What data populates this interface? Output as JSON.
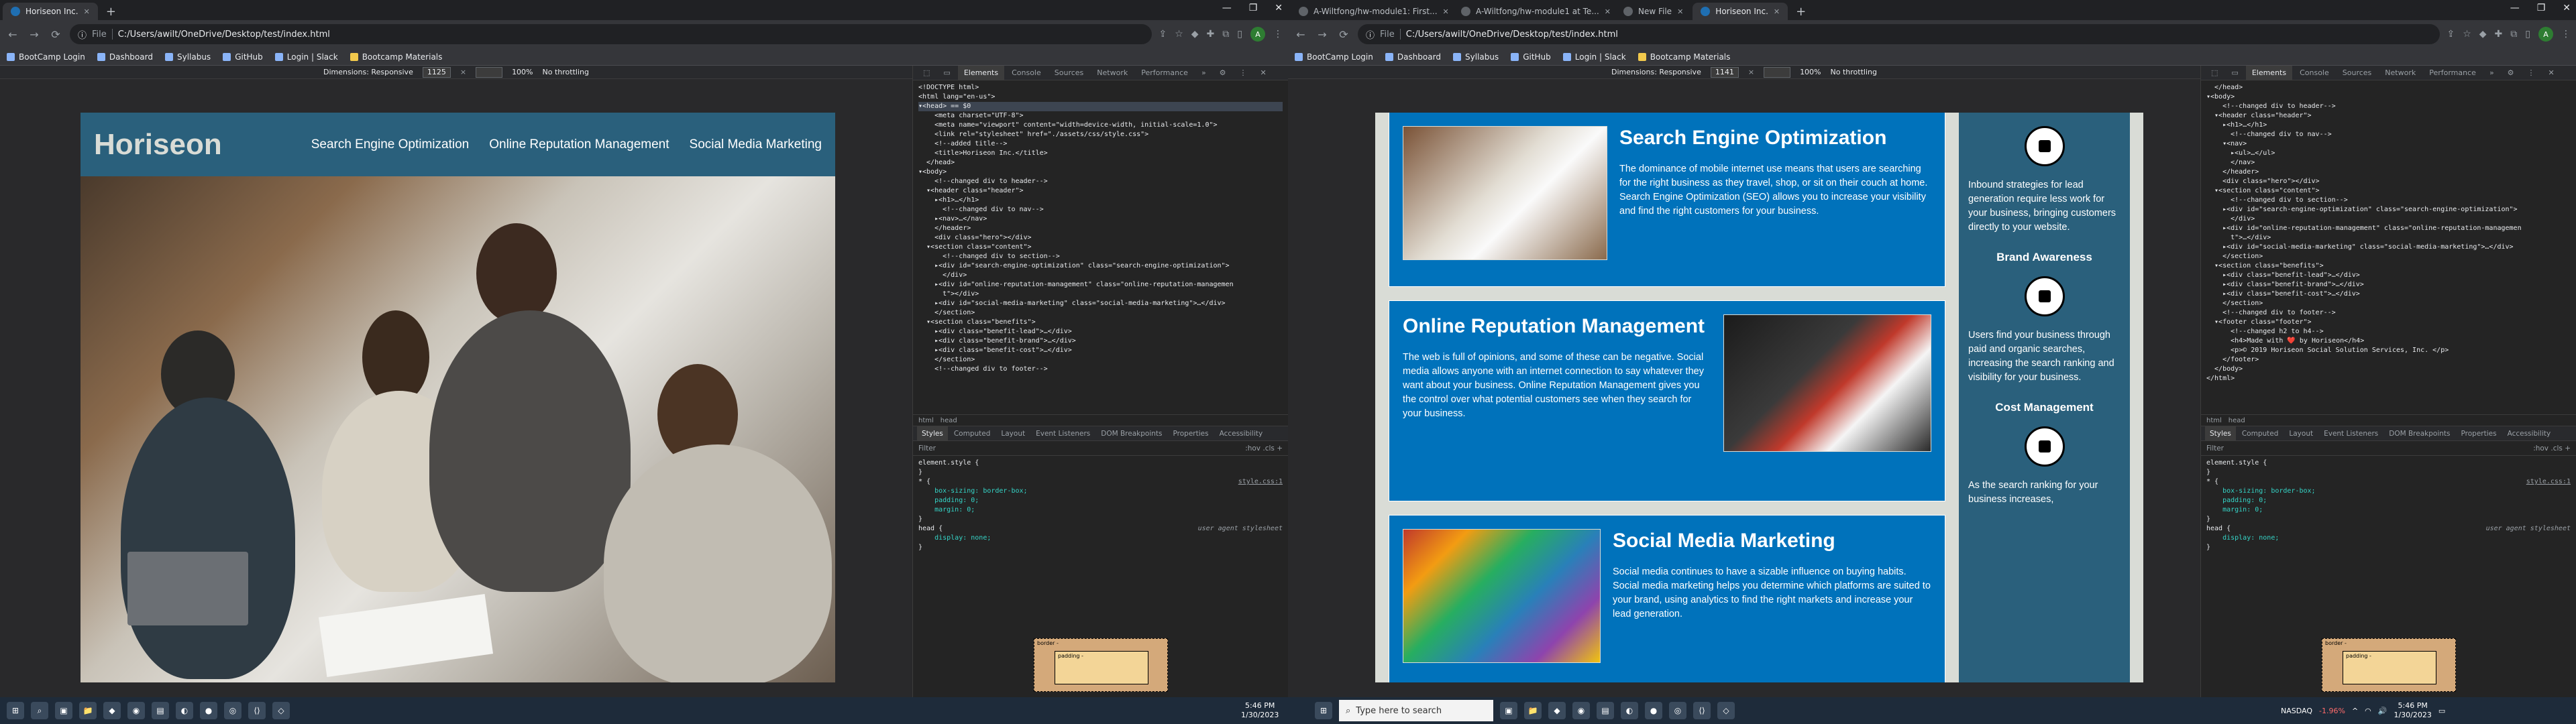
{
  "left": {
    "tabs": [
      {
        "title": "Horiseon Inc."
      }
    ],
    "url_label": "File",
    "url": "C:/Users/awilt/OneDrive/Desktop/test/index.html",
    "bookmarks": [
      "BootCamp Login",
      "Dashboard",
      "Syllabus",
      "GitHub",
      "Login | Slack",
      "Bootcamp Materials"
    ],
    "devbar": {
      "dimensions": "Dimensions: Responsive",
      "width": "1125",
      "zoom": "100%",
      "throttle": "No throttling"
    },
    "page": {
      "logo": "Horiseon",
      "nav": [
        "Search Engine Optimization",
        "Online Reputation Management",
        "Social Media Marketing"
      ]
    },
    "devtools": {
      "tabs": [
        "Elements",
        "Console",
        "Sources",
        "Network",
        "Performance"
      ],
      "code": [
        "<!DOCTYPE html>",
        "<html lang=\"en-us\">",
        "▾<head> == $0",
        "    <meta charset=\"UTF-8\">",
        "    <meta name=\"viewport\" content=\"width=device-width, initial-scale=1.0\">",
        "    <link rel=\"stylesheet\" href=\"./assets/css/style.css\">",
        "    <!--added title-->",
        "    <title>Horiseon Inc.</title>",
        "  </head>",
        "▾<body>",
        "    <!--changed div to header-->",
        "  ▾<header class=\"header\">",
        "    ▸<h1>…</h1>",
        "      <!--changed div to nav-->",
        "    ▸<nav>…</nav>",
        "    </header>",
        "    <div class=\"hero\"></div>",
        "  ▾<section class=\"content\">",
        "      <!--changed div to section-->",
        "    ▸<div id=\"search-engine-optimization\" class=\"search-engine-optimization\">",
        "      </div>",
        "    ▸<div id=\"online-reputation-management\" class=\"online-reputation-managemen",
        "      t\"></div>",
        "    ▸<div id=\"social-media-marketing\" class=\"social-media-marketing\">…</div>",
        "    </section>",
        "  ▾<section class=\"benefits\">",
        "    ▸<div class=\"benefit-lead\">…</div>",
        "    ▸<div class=\"benefit-brand\">…</div>",
        "    ▸<div class=\"benefit-cost\">…</div>",
        "    </section>",
        "    <!--changed div to footer-->"
      ],
      "crumbs": [
        "html",
        "head"
      ],
      "subtabs": [
        "Styles",
        "Computed",
        "Layout",
        "Event Listeners",
        "DOM Breakpoints",
        "Properties",
        "Accessibility"
      ],
      "filter": "Filter",
      "filter_right": ":hov .cls +",
      "styles": [
        {
          "t": "element.style {"
        },
        {
          "t": "}"
        },
        {
          "t": "* {",
          "src": "style.css:1"
        },
        {
          "t": "    box-sizing: border-box;"
        },
        {
          "t": "    padding: 0;"
        },
        {
          "t": "    margin: 0;"
        },
        {
          "t": "}"
        },
        {
          "t": "head {",
          "ua": "user agent stylesheet"
        },
        {
          "t": "    display: none;"
        },
        {
          "t": "}"
        }
      ]
    }
  },
  "right": {
    "tabs": [
      {
        "title": "A-Wiltfong/hw-module1: First..."
      },
      {
        "title": "A-Wiltfong/hw-module1 at Te..."
      },
      {
        "title": "New File"
      },
      {
        "title": "Horiseon Inc."
      }
    ],
    "url_label": "File",
    "url": "C:/Users/awilt/OneDrive/Desktop/test/index.html",
    "bookmarks": [
      "BootCamp Login",
      "Dashboard",
      "Syllabus",
      "GitHub",
      "Login | Slack",
      "Bootcamp Materials"
    ],
    "devbar": {
      "dimensions": "Dimensions: Responsive",
      "width": "1141",
      "zoom": "100%",
      "throttle": "No throttling"
    },
    "page": {
      "cards": [
        {
          "title": "Search Engine Optimization",
          "text": "The dominance of mobile internet use means that users are searching for the right business as they travel, shop, or sit on their couch at home. Search Engine Optimization (SEO) allows you to increase your visibility and find the right customers for your business.",
          "image": "seo"
        },
        {
          "title": "Online Reputation Management",
          "text": "The web is full of opinions, and some of these can be negative. Social media allows anyone with an internet connection to say whatever they want about your business. Online Reputation Management gives you the control over what potential customers see when they search for your business.",
          "image": "reputation"
        },
        {
          "title": "Social Media Marketing",
          "text": "Social media continues to have a sizable influence on buying habits. Social media marketing helps you determine which platforms are suited to your brand, using analytics to find the right markets and increase your lead generation.",
          "image": "social"
        }
      ],
      "side": [
        {
          "title": "",
          "text": "Inbound strategies for lead generation require less work for your business, bringing customers directly to your website."
        },
        {
          "title": "Brand Awareness",
          "text": "Users find your business through paid and organic searches, increasing the search ranking and visibility for your business."
        },
        {
          "title": "Cost Management",
          "text": "As the search ranking for your business increases,"
        }
      ]
    },
    "devtools": {
      "tabs": [
        "Elements",
        "Console",
        "Sources",
        "Network",
        "Performance"
      ],
      "code": [
        "  </head>",
        "▾<body>",
        "    <!--changed div to header-->",
        "  ▾<header class=\"header\">",
        "    ▸<h1>…</h1>",
        "      <!--changed div to nav-->",
        "    ▾<nav>",
        "      ▸<ul>…</ul>",
        "      </nav>",
        "    </header>",
        "    <div class=\"hero\"></div>",
        "  ▾<section class=\"content\">",
        "      <!--changed div to section-->",
        "    ▸<div id=\"search-engine-optimization\" class=\"search-engine-optimization\">",
        "      </div>",
        "    ▸<div id=\"online-reputation-management\" class=\"online-reputation-managemen",
        "      t\">…</div>",
        "    ▸<div id=\"social-media-marketing\" class=\"social-media-marketing\">…</div>",
        "    </section>",
        "  ▾<section class=\"benefits\">",
        "    ▸<div class=\"benefit-lead\">…</div>",
        "    ▸<div class=\"benefit-brand\">…</div>",
        "    ▸<div class=\"benefit-cost\">…</div>",
        "    </section>",
        "    <!--changed div to footer-->",
        "  ▾<footer class=\"footer\">",
        "      <!--changed h2 to h4-->",
        "      <h4>Made with ❤️ by Horiseon</h4>",
        "      <p>© 2019 Horiseon Social Solution Services, Inc. </p>",
        "    </footer>",
        "  </body>",
        "</html>"
      ],
      "crumbs": [
        "html",
        "head"
      ],
      "subtabs": [
        "Styles",
        "Computed",
        "Layout",
        "Event Listeners",
        "DOM Breakpoints",
        "Properties",
        "Accessibility"
      ],
      "filter": "Filter",
      "filter_right": ":hov .cls +",
      "styles": [
        {
          "t": "element.style {"
        },
        {
          "t": "}"
        },
        {
          "t": "* {",
          "src": "style.css:1"
        },
        {
          "t": "    box-sizing: border-box;"
        },
        {
          "t": "    padding: 0;"
        },
        {
          "t": "    margin: 0;"
        },
        {
          "t": "}"
        },
        {
          "t": "head {",
          "ua": "user agent stylesheet"
        },
        {
          "t": "    display: none;"
        },
        {
          "t": "}"
        }
      ]
    }
  },
  "taskbar": {
    "search_placeholder": "Type here to search",
    "left_time": "5:46 PM",
    "left_date": "1/30/2023",
    "ticker": "NASDAQ",
    "ticker_change": "-1.96%",
    "right_time": "5:46 PM",
    "right_date": "1/30/2023"
  },
  "colors": {
    "header": "#2a607c",
    "card": "#0072bb",
    "page_bg": "#d9dcd6"
  }
}
